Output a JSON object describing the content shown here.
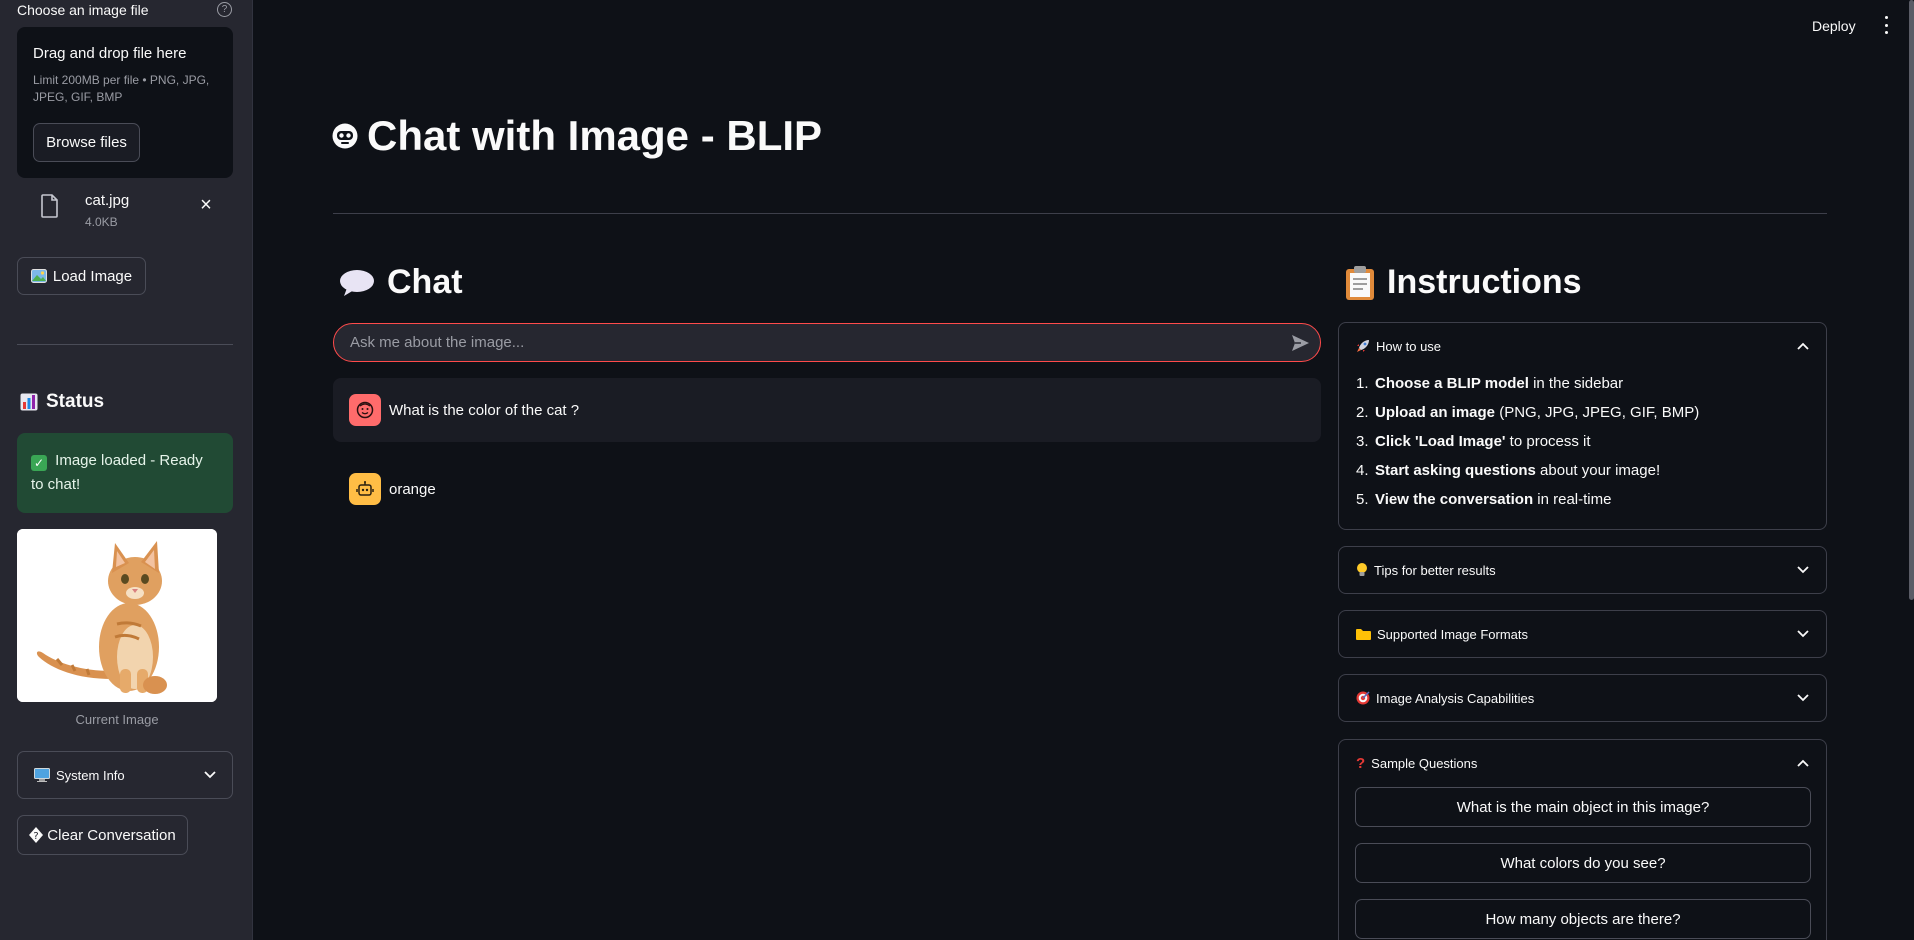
{
  "sidebar": {
    "uploader_label": "Choose an image file",
    "dropzone_title": "Drag and drop file here",
    "dropzone_limit": "Limit 200MB per file • PNG, JPG, JPEG, GIF, BMP",
    "browse_label": "Browse files",
    "file_name": "cat.jpg",
    "file_size": "4.0KB",
    "load_label": "Load Image",
    "status_title": "Status",
    "status_message": "Image loaded - Ready to chat!",
    "image_caption": "Current Image",
    "system_info_label": "System Info",
    "clear_label": "Clear Conversation"
  },
  "header": {
    "deploy_label": "Deploy"
  },
  "main": {
    "title": "Chat with Image - BLIP",
    "chat_title": "Chat",
    "chat_placeholder": "Ask me about the image...",
    "messages": [
      {
        "role": "user",
        "text": "What is the color of the cat ?"
      },
      {
        "role": "assistant",
        "text": "orange"
      }
    ]
  },
  "instructions": {
    "title": "Instructions",
    "how_to_use_label": "How to use",
    "steps": [
      {
        "num": "1.",
        "bold": "Choose a BLIP model",
        "rest": " in the sidebar"
      },
      {
        "num": "2.",
        "bold": "Upload an image",
        "rest": " (PNG, JPG, JPEG, GIF, BMP)"
      },
      {
        "num": "3.",
        "bold": "Click 'Load Image'",
        "rest": " to process it"
      },
      {
        "num": "4.",
        "bold": "Start asking questions",
        "rest": " about your image!"
      },
      {
        "num": "5.",
        "bold": "View the conversation",
        "rest": " in real-time"
      }
    ],
    "tips_label": "Tips for better results",
    "formats_label": "Supported Image Formats",
    "capabilities_label": "Image Analysis Capabilities",
    "sample_label": "Sample Questions",
    "sample_questions": [
      "What is the main object in this image?",
      "What colors do you see?",
      "How many objects are there?"
    ]
  },
  "icons": {
    "help": "help-circle-icon",
    "file": "file-icon",
    "close": "close-icon",
    "load": "picture-icon",
    "status": "bar-chart-icon",
    "check": "check-box-icon",
    "computer": "computer-icon",
    "clear": "unknown-glyph-icon",
    "title": "robot-face-icon",
    "chat": "speech-bubble-icon",
    "send": "send-icon",
    "user_avatar": "user-face-icon",
    "bot_avatar": "robot-icon",
    "instructions": "clipboard-icon",
    "how_to_use": "rocket-icon",
    "tips": "lightbulb-icon",
    "formats": "folder-icon",
    "capabilities": "target-icon",
    "sample": "question-mark-icon"
  },
  "colors": {
    "background": "#0e1117",
    "sidebar": "#262730",
    "accent": "#ff4b4b",
    "success_bg": "#214a34",
    "user_avatar": "#ff6b6b",
    "bot_avatar": "#ffbd45"
  }
}
